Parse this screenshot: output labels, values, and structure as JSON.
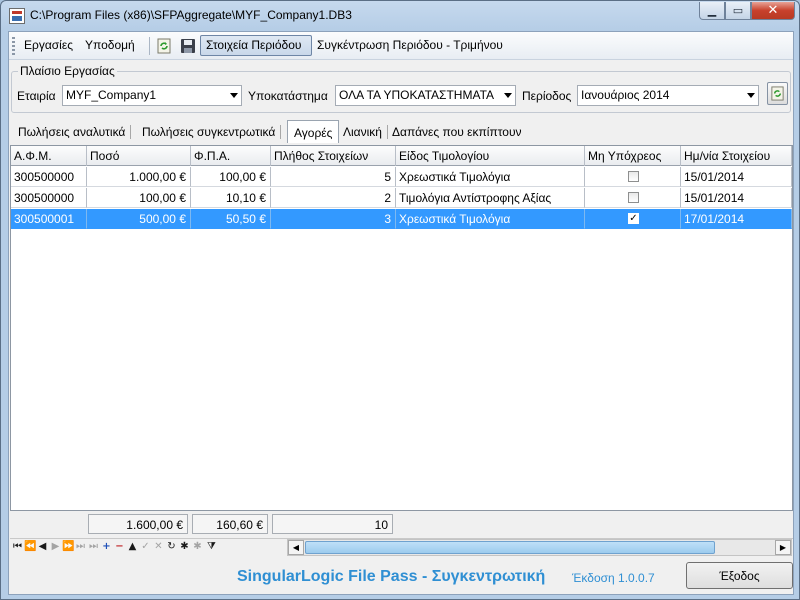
{
  "window": {
    "title": "C:\\Program Files (x86)\\SFPAggregate\\MYF_Company1.DB3"
  },
  "toolbar": {
    "menu_tasks": "Εργασίες",
    "menu_infra": "Υποδομή",
    "period_data": "Στοιχεία Περιόδου",
    "period_aggregate": "Συγκέντρωση Περιόδου - Τριμήνου"
  },
  "workspace": {
    "legend": "Πλαίσιο Εργασίας",
    "company_label": "Εταιρία",
    "company_value": "MYF_Company1",
    "branch_label": "Υποκατάστημα",
    "branch_value": "ΟΛΑ ΤΑ ΥΠΟΚΑΤΑΣΤΗΜΑΤΑ",
    "period_label": "Περίοδος",
    "period_value": "Ιανουάριος 2014"
  },
  "tabs": [
    {
      "label": "Πωλήσεις αναλυτικά"
    },
    {
      "label": "Πωλήσεις συγκεντρωτικά"
    },
    {
      "label": "Αγορές"
    },
    {
      "label": "Λιανική"
    },
    {
      "label": "Δαπάνες που εκπίπτουν"
    }
  ],
  "active_tab": "Αγορές",
  "grid": {
    "columns": [
      "Α.Φ.Μ.",
      "Ποσό",
      "Φ.Π.Α.",
      "Πλήθος Στοιχείων",
      "Είδος Τιμολογίου",
      "Μη Υπόχρεος",
      "Ημ/νία Στοιχείου"
    ],
    "rows": [
      {
        "afm": "300500000",
        "amount": "1.000,00 €",
        "vat": "100,00 €",
        "count": "5",
        "type": "Χρεωστικά Τιμολόγια",
        "exempt": false,
        "date": "15/01/2014",
        "selected": false
      },
      {
        "afm": "300500000",
        "amount": "100,00 €",
        "vat": "10,10 €",
        "count": "2",
        "type": "Τιμολόγια Αντίστροφης Αξίας",
        "exempt": false,
        "date": "15/01/2014",
        "selected": false
      },
      {
        "afm": "300500001",
        "amount": "500,00 €",
        "vat": "50,50 €",
        "count": "3",
        "type": "Χρεωστικά Τιμολόγια",
        "exempt": true,
        "date": "17/01/2014",
        "selected": true
      }
    ],
    "selection_color": "#3399ff"
  },
  "totals": {
    "amount": "1.600,00 €",
    "vat": "160,60 €",
    "count": "10"
  },
  "footer": {
    "brand": "SingularLogic File Pass - Συγκεντρωτική",
    "version": "Έκδοση 1.0.0.7",
    "exit_label": "Έξοδος",
    "brand_color": "#2f8fd3"
  }
}
